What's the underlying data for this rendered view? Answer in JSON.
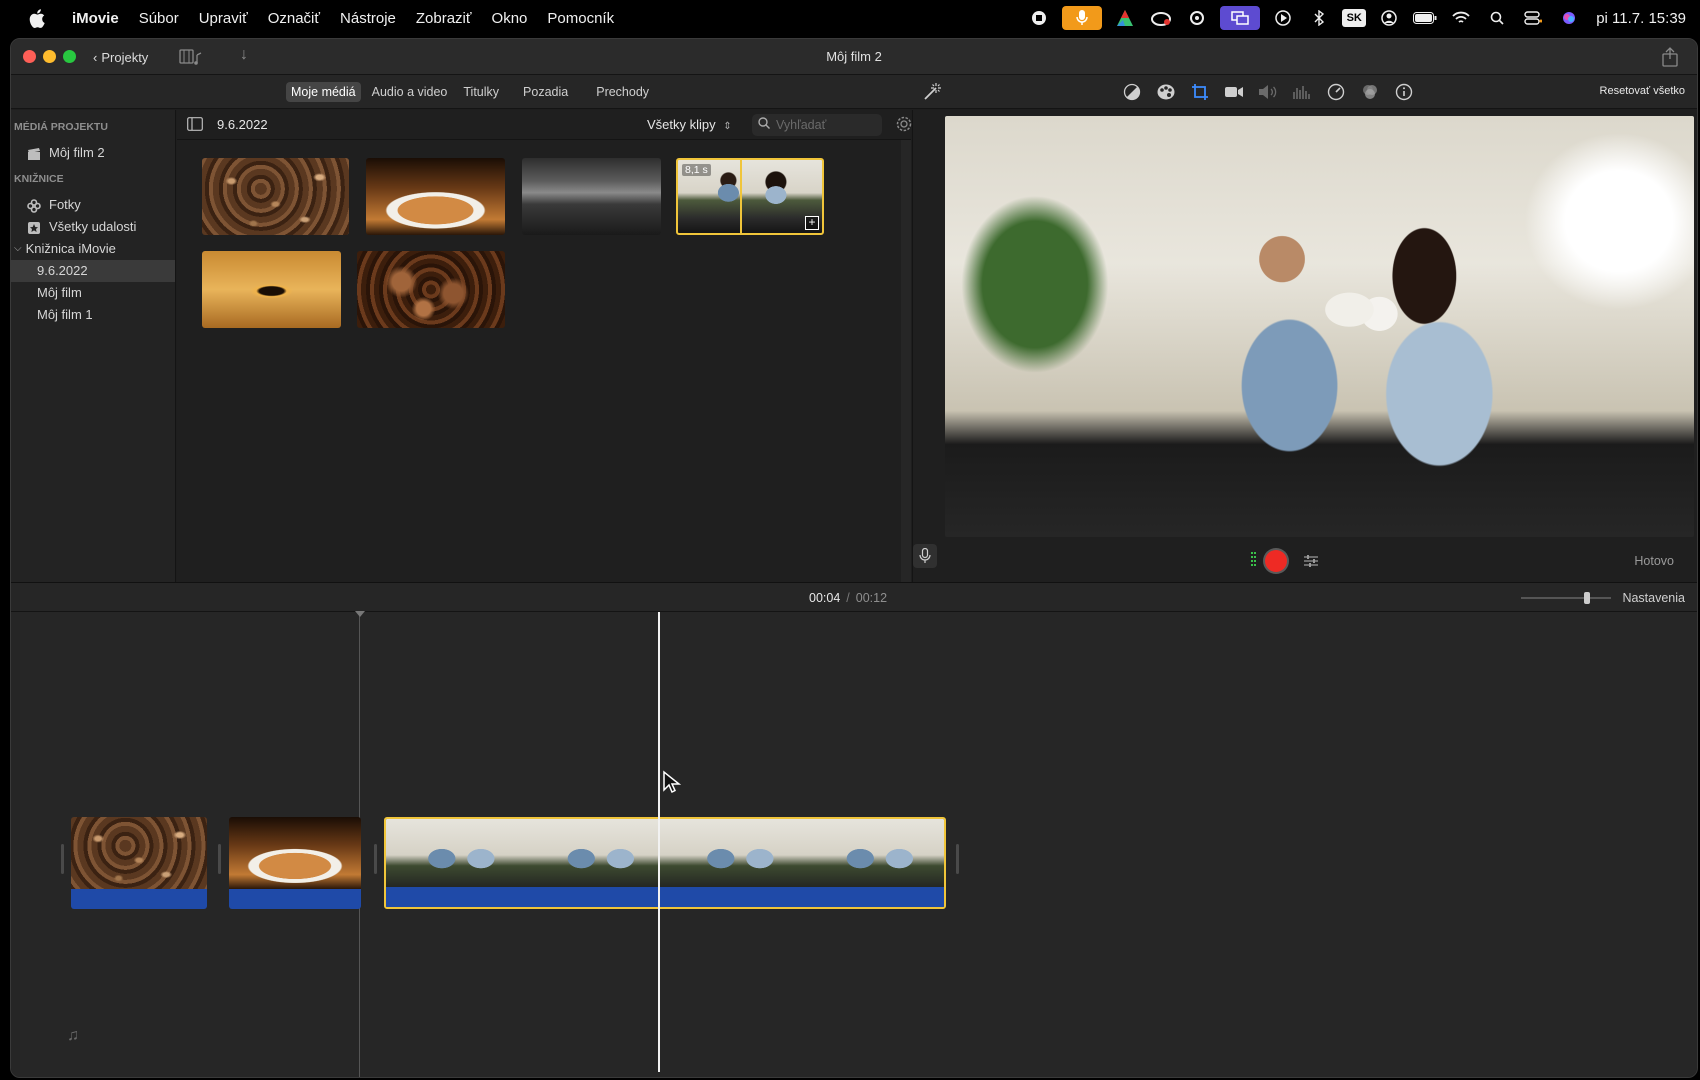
{
  "menubar": {
    "app_name": "iMovie",
    "items": [
      "Súbor",
      "Upraviť",
      "Označiť",
      "Nástroje",
      "Zobraziť",
      "Okno",
      "Pomocník"
    ],
    "keyboard_layout": "SK",
    "clock": "pi 11.7.  15:39"
  },
  "window": {
    "title": "Môj film 2",
    "projects_label": "Projekty"
  },
  "toolbar": {
    "tabs": [
      "Moje médiá",
      "Audio a video",
      "Titulky",
      "Pozadia",
      "Prechody"
    ],
    "active_tab": "Moje médiá",
    "reset_all_label": "Resetovať všetko",
    "adjust_icons": [
      "color-balance-icon",
      "color-correction-icon",
      "crop-icon",
      "stabilization-icon",
      "volume-icon",
      "noise-reduction-icon",
      "speed-icon",
      "clip-filter-icon",
      "info-icon"
    ]
  },
  "sidebar": {
    "project_media_header": "MÉDIÁ PROJEKTU",
    "project_item": "Môj film 2",
    "libraries_header": "KNIŽNICE",
    "photos": "Fotky",
    "all_events": "Všetky udalosti",
    "library": "Knižnica iMovie",
    "events": [
      "9.6.2022",
      "Môj film",
      "Môj film 1"
    ],
    "selected_event": "9.6.2022"
  },
  "browser": {
    "event_title": "9.6.2022",
    "clip_filter": "Všetky klipy",
    "search_placeholder": "Vyhľadať",
    "selected_clip_duration": "8,1 s",
    "clips": [
      "coffee-beans",
      "coffee-cup-splash",
      "espresso-machine",
      "couple-drinking-coffee",
      "coffee-drop",
      "roasted-beans"
    ]
  },
  "viewer": {
    "done_label": "Hotovo"
  },
  "timeline": {
    "current_time": "00:04",
    "separator": "/",
    "total_time": "00:12",
    "settings_label": "Nastavenia",
    "zoom_level": 0.75,
    "clips": [
      "coffee-beans",
      "coffee-cup-splash",
      "couple-drinking-coffee"
    ]
  },
  "colors": {
    "selection": "#f0c53a",
    "audio_track": "#1f4aa8",
    "record": "#ee2a24",
    "mic_status": "#f29a1a",
    "screen_status": "#5d4bd1"
  }
}
